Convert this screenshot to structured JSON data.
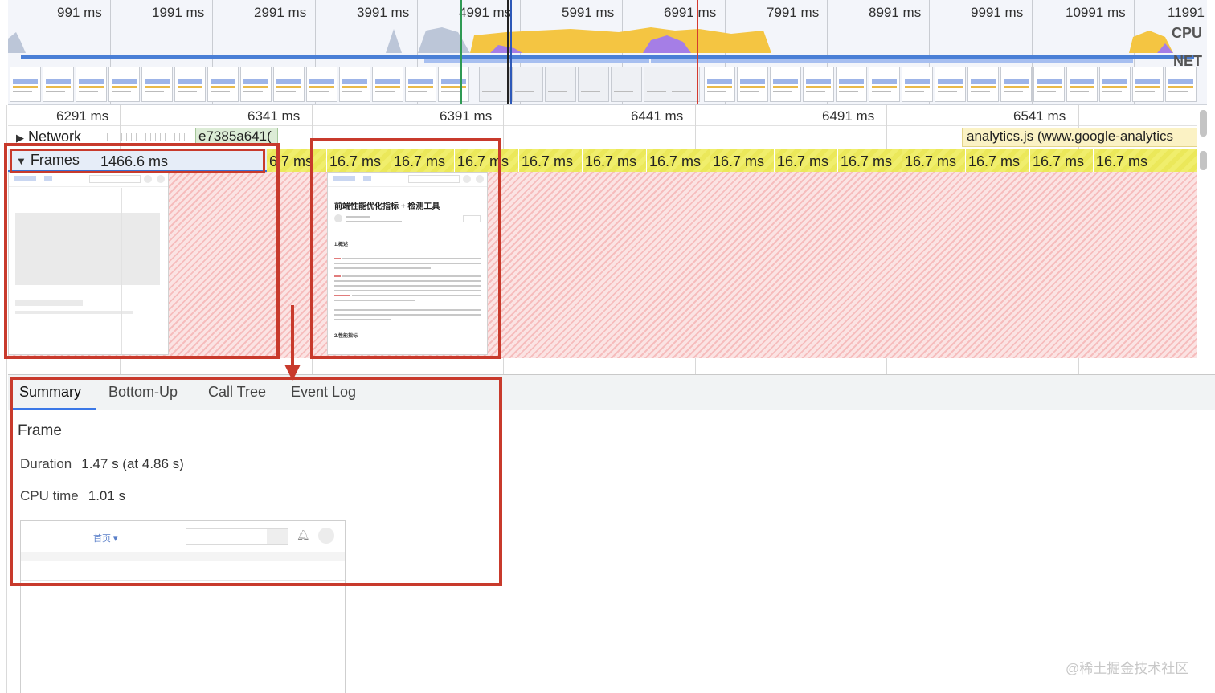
{
  "overview": {
    "time_labels": [
      "991 ms",
      "1991 ms",
      "2991 ms",
      "3991 ms",
      "4991 ms",
      "5991 ms",
      "6991 ms",
      "7991 ms",
      "8991 ms",
      "9991 ms",
      "10991 ms",
      "11991"
    ],
    "cpu_label": "CPU",
    "net_label": "NET",
    "colors": {
      "scripting": "#f4c542",
      "rendering": "#a57ee6",
      "painting": "#7cc36a",
      "idle": "#bcc6d8",
      "network": "#4a7fd6"
    }
  },
  "ruler": {
    "labels": [
      "6291 ms",
      "6341 ms",
      "6391 ms",
      "6441 ms",
      "6491 ms",
      "6541 ms"
    ]
  },
  "network": {
    "title": "Network",
    "request_1": "e7385a641(",
    "request_2": "analytics.js (www.google-analytics"
  },
  "frames": {
    "title": "Frames",
    "selected_duration": "1466.6 ms",
    "partial_label": "6.7 ms",
    "cells": [
      "16.7 ms",
      "16.7 ms",
      "16.7 ms",
      "16.7 ms",
      "16.7 ms",
      "16.7 ms",
      "16.7 ms",
      "16.7 ms",
      "16.7 ms",
      "16.7 ms",
      "16.7 ms",
      "16.7 ms",
      "16.7 ms"
    ],
    "article": {
      "title": "前端性能优化指标 + 检测工具",
      "h1": "1.概述",
      "h2": "2.性能指标"
    }
  },
  "details": {
    "tabs": [
      "Summary",
      "Bottom-Up",
      "Call Tree",
      "Event Log"
    ],
    "active_tab": "Summary",
    "summary": {
      "title": "Frame",
      "duration_key": "Duration",
      "duration_value": "1.47 s (at 4.86 s)",
      "cpu_key": "CPU time",
      "cpu_value": "1.01 s",
      "preview_nav": "首页 ▾"
    }
  },
  "watermark": "@稀土掘金技术社区"
}
